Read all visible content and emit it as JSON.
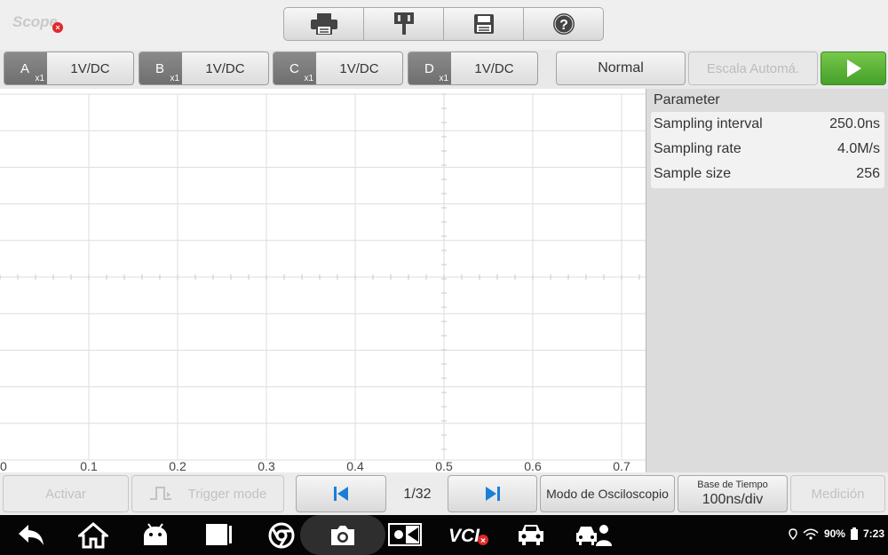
{
  "app": {
    "title": "Scope"
  },
  "toolbar": {
    "icons": [
      "printer-icon",
      "pin-icon",
      "save-icon",
      "help-icon"
    ]
  },
  "channels": [
    {
      "letter": "A",
      "probe": "x1",
      "volt": "1V/DC"
    },
    {
      "letter": "B",
      "probe": "x1",
      "volt": "1V/DC"
    },
    {
      "letter": "C",
      "probe": "x1",
      "volt": "1V/DC"
    },
    {
      "letter": "D",
      "probe": "x1",
      "volt": "1V/DC"
    }
  ],
  "controls": {
    "normal": "Normal",
    "auto_scale": "Escala Automá."
  },
  "plot": {
    "x_ticks": [
      "0",
      "0.1",
      "0.2",
      "0.3",
      "0.4",
      "0.5",
      "0.6",
      "0.7"
    ],
    "grid_color": "#dddddd"
  },
  "parameters": {
    "title": "Parameter",
    "rows": [
      {
        "label": "Sampling interval",
        "value": "250.0ns"
      },
      {
        "label": "Sampling rate",
        "value": "4.0M/s"
      },
      {
        "label": "Sample size",
        "value": "256"
      }
    ]
  },
  "bottom": {
    "activate": "Activar",
    "trigger_mode": "Trigger mode",
    "page": "1/32",
    "scope_mode": "Modo de Osciloscopio",
    "timebase_label": "Base de Tiempo",
    "timebase_value": "100ns/div",
    "measure": "Medición"
  },
  "status": {
    "battery": "90%",
    "time": "7:23"
  },
  "colors": {
    "accent_green": "#45a02a",
    "nav_blue": "#1a7ed8",
    "error_red": "#e0282b"
  }
}
